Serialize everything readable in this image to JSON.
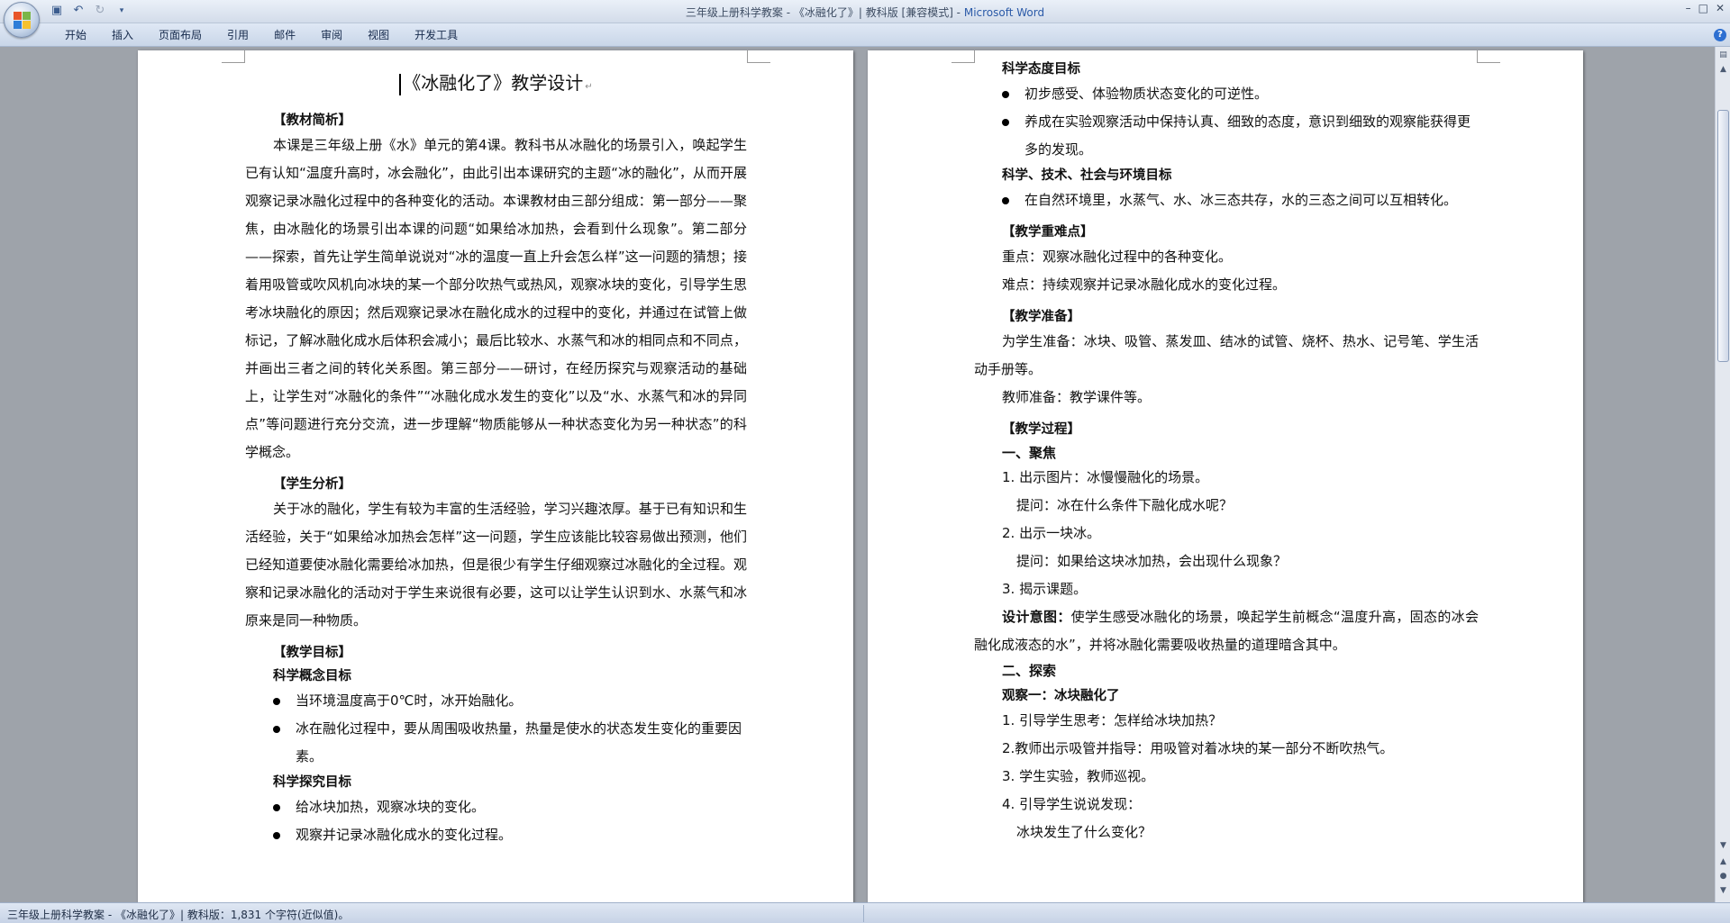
{
  "window": {
    "title_doc": "三年级上册科学教案 - 《冰融化了》| 教科版 [兼容模式] - ",
    "title_app": "Microsoft Word",
    "controls": [
      "–",
      "□",
      "✕"
    ]
  },
  "qat": [
    "save-icon",
    "undo-icon",
    "redo-icon",
    "customize-icon"
  ],
  "ribbon": {
    "tabs": [
      "开始",
      "插入",
      "页面布局",
      "引用",
      "邮件",
      "审阅",
      "视图",
      "开发工具"
    ]
  },
  "doc": {
    "title": "《冰融化了》教学设计",
    "left": {
      "h_material": "【教材简析】",
      "p_material": "本课是三年级上册《水》单元的第4课。教科书从冰融化的场景引入，唤起学生已有认知“温度升高时，冰会融化”，由此引出本课研究的主题“冰的融化”，从而开展观察记录冰融化过程中的各种变化的活动。本课教材由三部分组成：第一部分——聚焦，由冰融化的场景引出本课的问题“如果给冰加热，会看到什么现象”。第二部分——探索，首先让学生简单说说对“冰的温度一直上升会怎么样”这一问题的猜想；接着用吸管或吹风机向冰块的某一个部分吹热气或热风，观察冰块的变化，引导学生思考冰块融化的原因；然后观察记录冰在融化成水的过程中的变化，并通过在试管上做标记，了解冰融化成水后体积会减小；最后比较水、水蒸气和冰的相同点和不同点，并画出三者之间的转化关系图。第三部分——研讨，在经历探究与观察活动的基础上，让学生对“冰融化的条件”“冰融化成水发生的变化”以及“水、水蒸气和冰的异同点”等问题进行充分交流，进一步理解“物质能够从一种状态变化为另一种状态”的科学概念。",
      "h_student": "【学生分析】",
      "p_student": "关于冰的融化，学生有较为丰富的生活经验，学习兴趣浓厚。基于已有知识和生活经验，关于“如果给冰加热会怎样”这一问题，学生应该能比较容易做出预测，他们已经知道要使冰融化需要给冰加热，但是很少有学生仔细观察过冰融化的全过程。观察和记录冰融化的活动对于学生来说很有必要，这可以让学生认识到水、水蒸气和冰原来是同一种物质。",
      "h_goals": "【教学目标】",
      "h_concept": "科学概念目标",
      "concept_items": [
        "当环境温度高于0℃时，冰开始融化。",
        "冰在融化过程中，要从周围吸收热量，热量是使水的状态发生变化的重要因素。"
      ],
      "h_inquiry": "科学探究目标",
      "inquiry_items": [
        "给冰块加热，观察冰块的变化。",
        "观察并记录冰融化成水的变化过程。"
      ]
    },
    "right": {
      "h_attitude": "科学态度目标",
      "attitude_items": [
        "初步感受、体验物质状态变化的可逆性。",
        "养成在实验观察活动中保持认真、细致的态度，意识到细致的观察能获得更多的发现。"
      ],
      "h_sts": "科学、技术、社会与环境目标",
      "sts_items": [
        "在自然环境里，水蒸气、水、冰三态共存，水的三态之间可以互相转化。"
      ],
      "h_key": "【教学重难点】",
      "key_point": "重点：观察冰融化过程中的各种变化。",
      "difficult_point": "难点：持续观察并记录冰融化成水的变化过程。",
      "h_prep": "【教学准备】",
      "prep_student": "为学生准备：冰块、吸管、蒸发皿、结冰的试管、烧杯、热水、记号笔、学生活动手册等。",
      "prep_teacher": "教师准备：教学课件等。",
      "h_process": "【教学过程】",
      "h_focus": "一、聚焦",
      "focus_1": "1. 出示图片：冰慢慢融化的场景。",
      "focus_1q": "提问：冰在什么条件下融化成水呢？",
      "focus_2": "2. 出示一块冰。",
      "focus_2q": "提问：如果给这块冰加热，会出现什么现象？",
      "focus_3": "3. 揭示课题。",
      "intent_label": "设计意图：",
      "intent_text": "使学生感受冰融化的场景，唤起学生前概念“温度升高，固态的冰会融化成液态的水”，并将冰融化需要吸收热量的道理暗含其中。",
      "h_explore": "二、探索",
      "h_obs1": "观察一：冰块融化了",
      "obs_1": "1. 引导学生思考：怎样给冰块加热？",
      "obs_2": "2.教师出示吸管并指导：用吸管对着冰块的某一部分不断吹热气。",
      "obs_3": "3. 学生实验，教师巡视。",
      "obs_4": "4. 引导学生说说发现：",
      "obs_4q": "冰块发生了什么变化？"
    }
  },
  "status": {
    "text": "三年级上册科学教案 - 《冰融化了》| 教科版：1,831 个字符(近似值)。"
  }
}
